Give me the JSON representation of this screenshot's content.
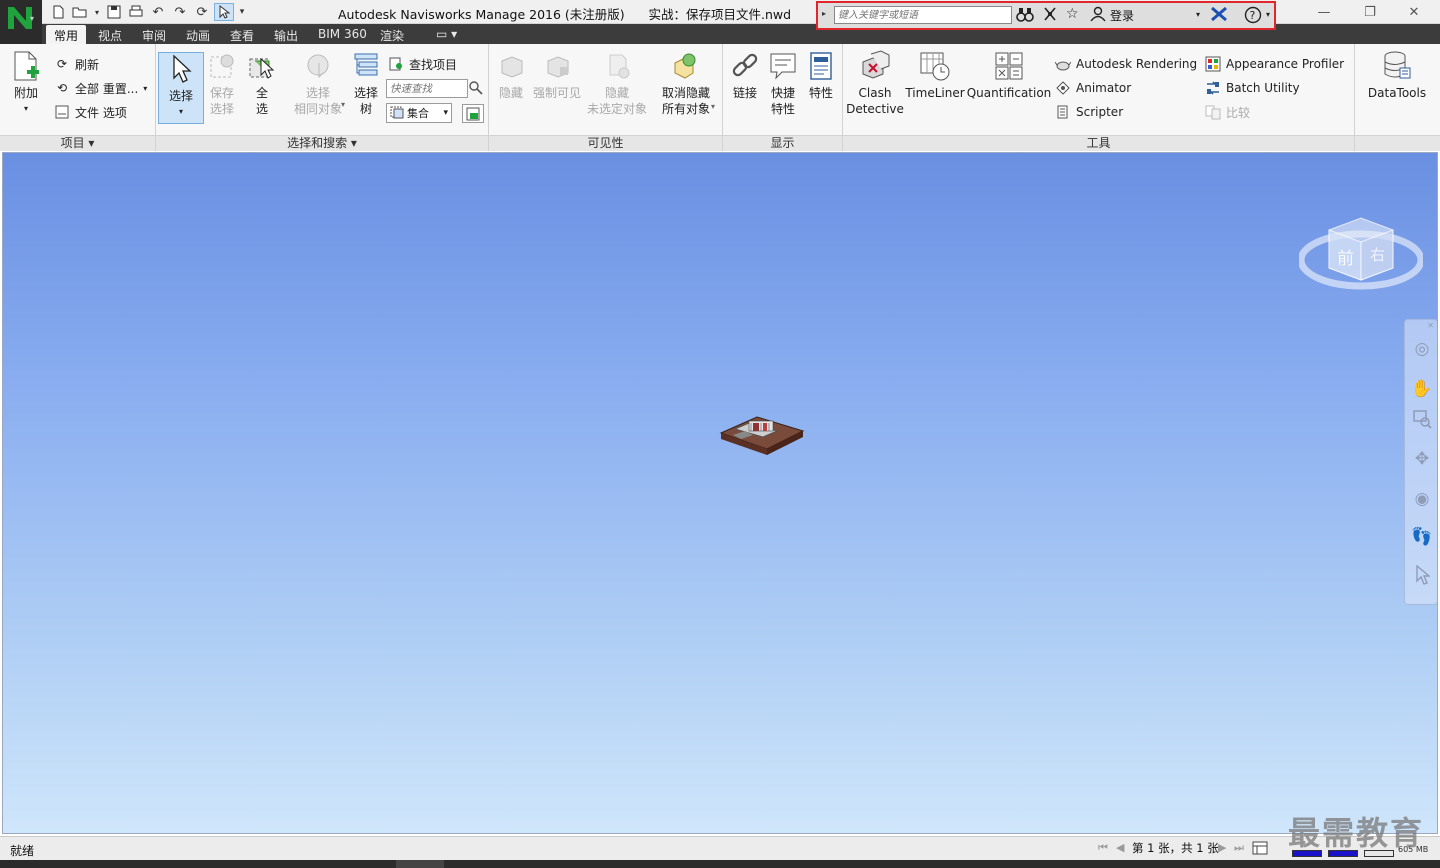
{
  "window": {
    "title": "Autodesk Navisworks Manage 2016 (未注册版)      实战：保存项目文件.nwd"
  },
  "infocenter": {
    "search_placeholder": "键入关键字或短语",
    "login_label": "登录"
  },
  "tabs": [
    {
      "label": "常用",
      "active": true
    },
    {
      "label": "视点"
    },
    {
      "label": "审阅"
    },
    {
      "label": "动画"
    },
    {
      "label": "查看"
    },
    {
      "label": "输出"
    },
    {
      "label": "BIM 360"
    },
    {
      "label": "渲染"
    }
  ],
  "panels": {
    "project": {
      "title": "项目 ▾",
      "append": "附加",
      "refresh": "刷新",
      "reset_all": "全部 重置...",
      "file_options": "文件 选项"
    },
    "select_search": {
      "title": "选择和搜索 ▾",
      "select": "选择",
      "save_selection_1": "保存",
      "save_selection_2": "选择",
      "select_all_1": "全",
      "select_all_2": "选",
      "select_same_1": "选择",
      "select_same_2": "相同对象",
      "selection_tree_1": "选择",
      "selection_tree_2": "树",
      "find_items": "查找项目",
      "quick_find_placeholder": "快速查找",
      "sets": "集合"
    },
    "visibility": {
      "title": "可见性",
      "hide": "隐藏",
      "require": "强制可见",
      "hide_unselected_1": "隐藏",
      "hide_unselected_2": "未选定对象",
      "unhide_all_1": "取消隐藏",
      "unhide_all_2": "所有对象"
    },
    "display": {
      "title": "显示",
      "links": "链接",
      "quick_props_1": "快捷",
      "quick_props_2": "特性",
      "properties": "特性"
    },
    "tools": {
      "title": "工具",
      "clash_1": "Clash",
      "clash_2": "Detective",
      "timeliner": "TimeLiner",
      "quantification": "Quantification",
      "autodesk_rendering": "Autodesk Rendering",
      "animator": "Animator",
      "scripter": "Scripter",
      "appearance_profiler": "Appearance Profiler",
      "batch_utility": "Batch Utility",
      "compare": "比较",
      "datatools": "DataTools"
    }
  },
  "viewcube": {
    "face_front": "前",
    "face_right": "右"
  },
  "status": {
    "text": "就绪",
    "page_info": "第 1 张，共 1 张",
    "memory": "605 MB"
  },
  "watermark": "最需教育",
  "colors": {
    "accent_red": "#e0262a",
    "logo_green": "#1fa33c",
    "selected_blue": "#cde3f7"
  }
}
